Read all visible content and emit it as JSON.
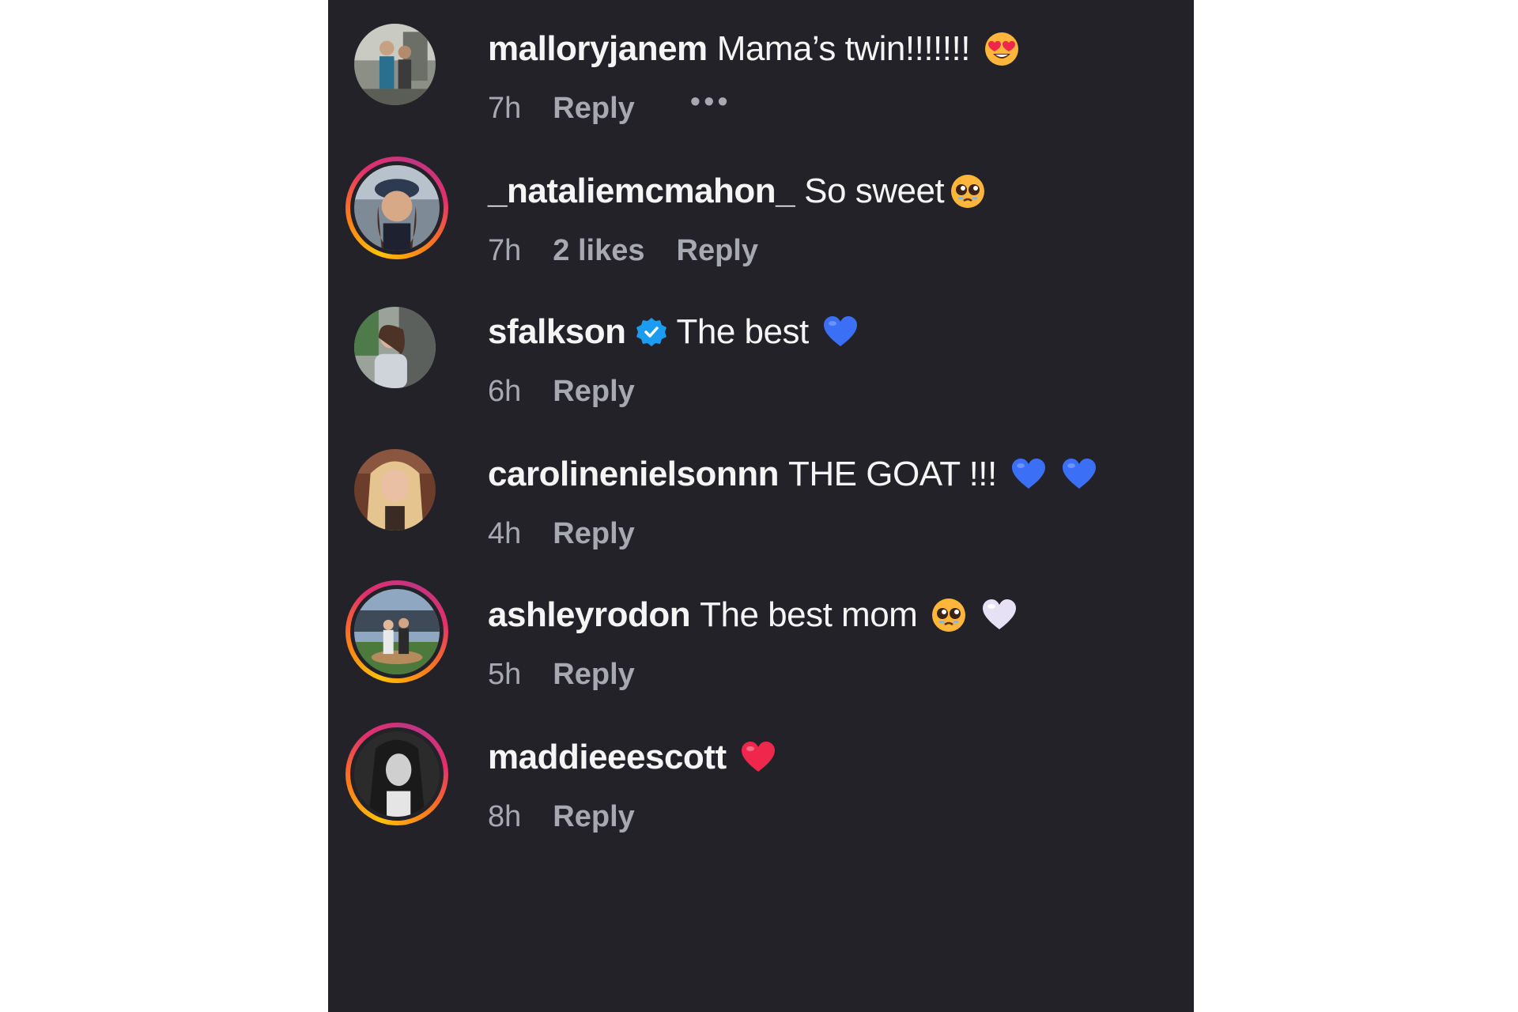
{
  "comments": [
    {
      "username": "malloryjanem",
      "text": "Mama’s twin!!!!!!!",
      "emoji": "heart-eyes-emoji",
      "time": "7h",
      "likes": "",
      "reply_label": "Reply",
      "more_label": "•••",
      "story_ring": false,
      "verified": false
    },
    {
      "username": "_nataliemcmahon_",
      "text": "So sweet",
      "emoji": "pleading-face-emoji",
      "time": "7h",
      "likes": "2 likes",
      "reply_label": "Reply",
      "story_ring": true,
      "verified": false
    },
    {
      "username": "sfalkson",
      "text": "The best",
      "emoji": "blue-heart-emoji",
      "time": "6h",
      "likes": "",
      "reply_label": "Reply",
      "story_ring": false,
      "verified": true
    },
    {
      "username": "carolinenielsonnn",
      "text": "THE GOAT !!!",
      "emoji": "blue-heart-emoji x2",
      "time": "4h",
      "likes": "",
      "reply_label": "Reply",
      "story_ring": false,
      "verified": false
    },
    {
      "username": "ashleyrodon",
      "text": "The best mom",
      "emoji": "pleading-face-emoji, white-heart-emoji",
      "time": "5h",
      "likes": "",
      "reply_label": "Reply",
      "story_ring": true,
      "verified": false
    },
    {
      "username": "maddieeescott",
      "text": "",
      "emoji": "red-heart-emoji",
      "time": "8h",
      "likes": "",
      "reply_label": "Reply",
      "story_ring": true,
      "verified": false
    }
  ],
  "colors": {
    "background": "#222228",
    "text_primary": "#f5f5f5",
    "text_secondary": "#a8a8b0",
    "verified_blue": "#1d9bf0",
    "blue_heart": "#3b6ff5",
    "red_heart": "#f0274d"
  }
}
